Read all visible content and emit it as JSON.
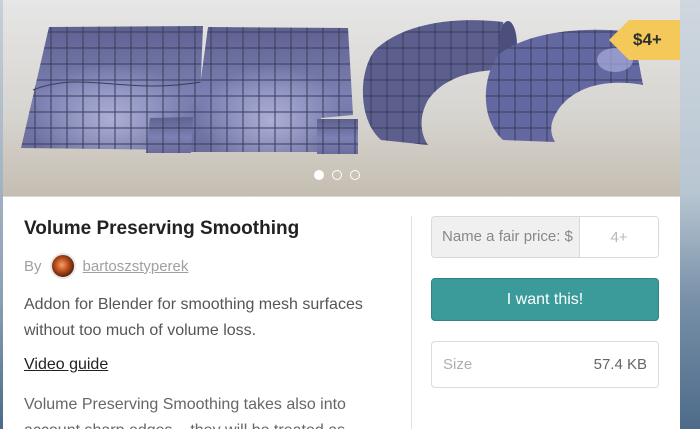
{
  "product": {
    "title": "Volume Preserving Smoothing",
    "by_label": "By",
    "author": "bartoszstyperek",
    "description": "Addon for Blender for smoothing mesh surfaces without too much of volume loss.",
    "video_link": "Video guide",
    "body_text": "Volume Preserving Smoothing  takes also into account sharp edges – they will be treated as"
  },
  "hero": {
    "price_tag": "$4+",
    "carousel_dots": 3,
    "active_dot": 0,
    "accent_color": "#f4c95a"
  },
  "purchase": {
    "price_label": "Name a fair price: $",
    "price_placeholder": "4+",
    "buy_button": "I want this!",
    "button_color": "#3a9b9a",
    "size_label": "Size",
    "size_value": "57.4 KB"
  }
}
